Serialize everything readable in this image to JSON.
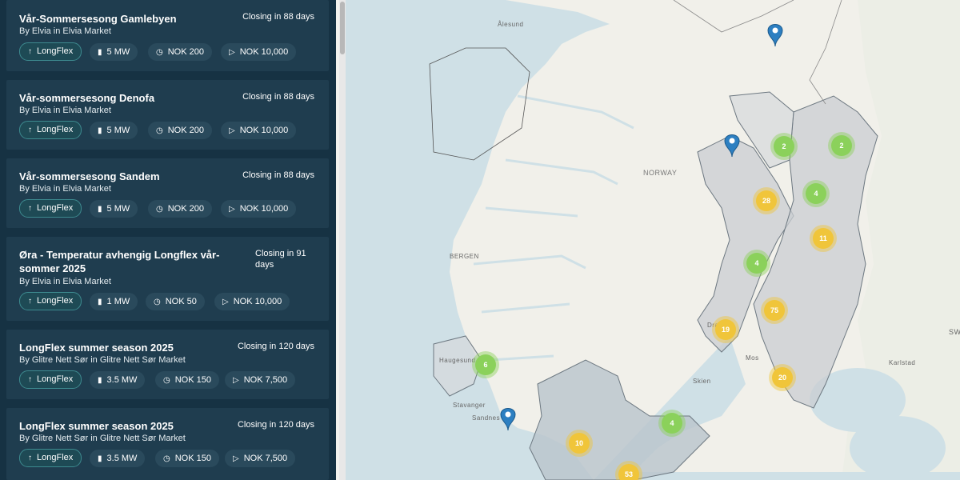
{
  "listings": [
    {
      "title": "Vår-Sommersesong Gamlebyen",
      "by": "By Elvia in Elvia Market",
      "closing": "Closing in 88 days",
      "product": "LongFlex",
      "power": "5 MW",
      "price": "NOK 200",
      "total": "NOK 10,000"
    },
    {
      "title": "Vår-sommersesong Denofa",
      "by": "By Elvia in Elvia Market",
      "closing": "Closing in 88 days",
      "product": "LongFlex",
      "power": "5 MW",
      "price": "NOK 200",
      "total": "NOK 10,000"
    },
    {
      "title": "Vår-sommersesong Sandem",
      "by": "By Elvia in Elvia Market",
      "closing": "Closing in 88 days",
      "product": "LongFlex",
      "power": "5 MW",
      "price": "NOK 200",
      "total": "NOK 10,000"
    },
    {
      "title": "Øra - Temperatur avhengig Longflex vår-sommer 2025",
      "by": "By Elvia in Elvia Market",
      "closing": "Closing in 91 days",
      "product": "LongFlex",
      "power": "1 MW",
      "price": "NOK 50",
      "total": "NOK 10,000"
    },
    {
      "title": "LongFlex summer season 2025",
      "by": "By Glitre Nett Sør in Glitre Nett Sør Market",
      "closing": "Closing in 120 days",
      "product": "LongFlex",
      "power": "3.5 MW",
      "price": "NOK 150",
      "total": "NOK 7,500"
    },
    {
      "title": "LongFlex summer season 2025",
      "by": "By Glitre Nett Sør in Glitre Nett Sør Market",
      "closing": "Closing in 120 days",
      "product": "LongFlex",
      "power": "3.5 MW",
      "price": "NOK 150",
      "total": "NOK 7,500"
    }
  ],
  "map": {
    "labels": {
      "alesund": "Ålesund",
      "norway": "NORWAY",
      "bergen": "BERGEN",
      "haugesund": "Haugesund",
      "stavanger": "Stavanger",
      "sandnes": "Sandnes",
      "skien": "Skien",
      "karlstad": "Karlstad",
      "dram": "Dra",
      "moss": "Mos",
      "sw": "SW"
    },
    "clusters": [
      "2",
      "2",
      "28",
      "4",
      "11",
      "4",
      "75",
      "19",
      "20",
      "6",
      "4",
      "10",
      "53"
    ],
    "colors": {
      "green": "#8bd15b",
      "yellow": "#f0c53a",
      "pin": "#2d7fc1"
    }
  }
}
